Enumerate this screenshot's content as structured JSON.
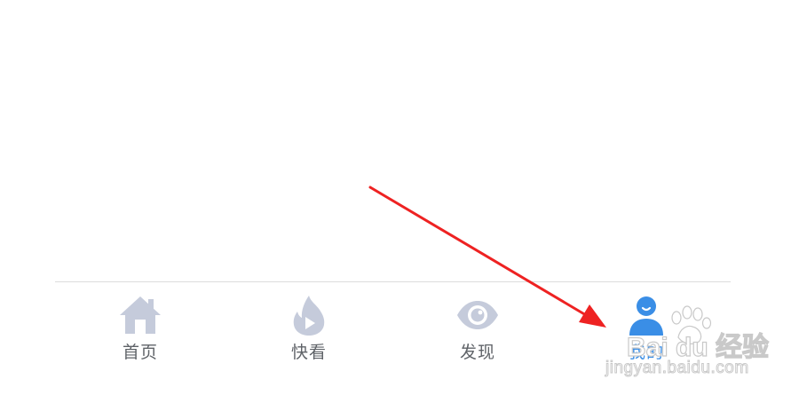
{
  "tabbar": {
    "tabs": [
      {
        "label": "首页",
        "icon": "home-icon",
        "active": false
      },
      {
        "label": "快看",
        "icon": "flame-play-icon",
        "active": false
      },
      {
        "label": "发现",
        "icon": "eye-icon",
        "active": false
      },
      {
        "label": "我的",
        "icon": "user-icon",
        "active": true
      }
    ]
  },
  "watermark": {
    "brand": "Bai du 经验",
    "url": "jingyan.baidu.com"
  },
  "colors": {
    "inactive_icon": "#c5cbdb",
    "active_icon": "#3a8ee6",
    "label": "#5f6368",
    "divider": "#dcdcdc",
    "arrow": "#ee2222"
  }
}
